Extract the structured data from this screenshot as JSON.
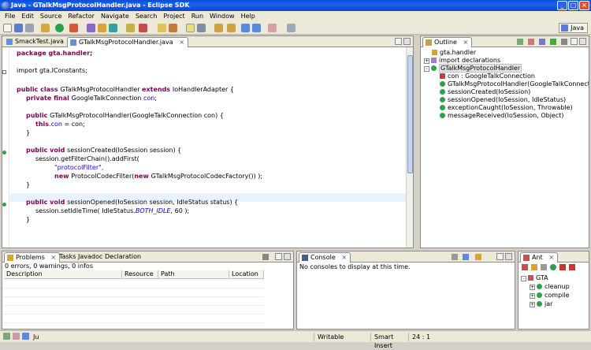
{
  "window": {
    "title": "Java - GTalkMsgProtocolHandler.java - Eclipse SDK"
  },
  "menu": [
    "File",
    "Edit",
    "Source",
    "Refactor",
    "Navigate",
    "Search",
    "Project",
    "Run",
    "Window",
    "Help"
  ],
  "perspective": {
    "label": "Java"
  },
  "editor": {
    "tabs": [
      {
        "label": "SmackTest.java",
        "active": false
      },
      {
        "label": "GTalkMsgProtocolHandler.java",
        "active": true
      }
    ],
    "lines": {
      "l1": "package gta.handler;",
      "l2": "import gta.IConstants;",
      "l3a": "public class ",
      "l3b": "GTalkMsgProtocolHandler ",
      "l3c": "extends ",
      "l3d": "IoHandlerAdapter {",
      "l4a": "private final ",
      "l4b": "GoogleTalkConnection ",
      "l4c": "con",
      "l5a": "public ",
      "l5b": "GTalkMsgProtocolHandler(GoogleTalkConnection con) {",
      "l6a": "this",
      "l6b": ".con",
      "l6c": " = con;",
      "l7": "}",
      "l8a": "public void ",
      "l8b": "sessionCreated(IoSession session) {",
      "l9": "session.getFilterChain().addFirst(",
      "l10": "\"protocolFilter\",",
      "l11a": "new ",
      "l11b": "ProtocolCodecFilter(",
      "l11c": "new ",
      "l11d": "GTalkMsgProtocolCodecFactory()) );",
      "l12": "}",
      "l13a": "public void ",
      "l13b": "sessionOpened(IoSession session, IdleStatus status) {",
      "l14a": "session.setIdleTime( IdleStatus.",
      "l14b": "BOTH_IDLE",
      "l14c": ", 60 );",
      "l15": "}"
    }
  },
  "outline": {
    "tab": "Outline",
    "items": [
      "gta.handler",
      "import declarations",
      "GTalkMsgProtocolHandler",
      "con : GoogleTalkConnection",
      "GTalkMsgProtocolHandler(GoogleTalkConnection",
      "sessionCreated(IoSession)",
      "sessionOpened(IoSession, IdleStatus)",
      "exceptionCaught(IoSession, Throwable)",
      "messageReceived(IoSession, Object)"
    ]
  },
  "problems": {
    "tabs": [
      "Problems",
      "Tasks",
      "Javadoc",
      "Declaration"
    ],
    "summary": "0 errors, 0 warnings, 0 infos",
    "columns": [
      "Description",
      "Resource",
      "Path",
      "Location"
    ]
  },
  "console": {
    "tab": "Console",
    "message": "No consoles to display at this time."
  },
  "ant": {
    "tab": "Ant",
    "root": "GTA",
    "targets": [
      "cleanup",
      "compile",
      "jar"
    ]
  },
  "status": {
    "writable": "Writable",
    "insert_mode": "Smart Insert",
    "position": "24 : 1"
  },
  "colors": {
    "keyword": "#7f0055",
    "string": "#2a00ff",
    "field": "#0000c0"
  }
}
